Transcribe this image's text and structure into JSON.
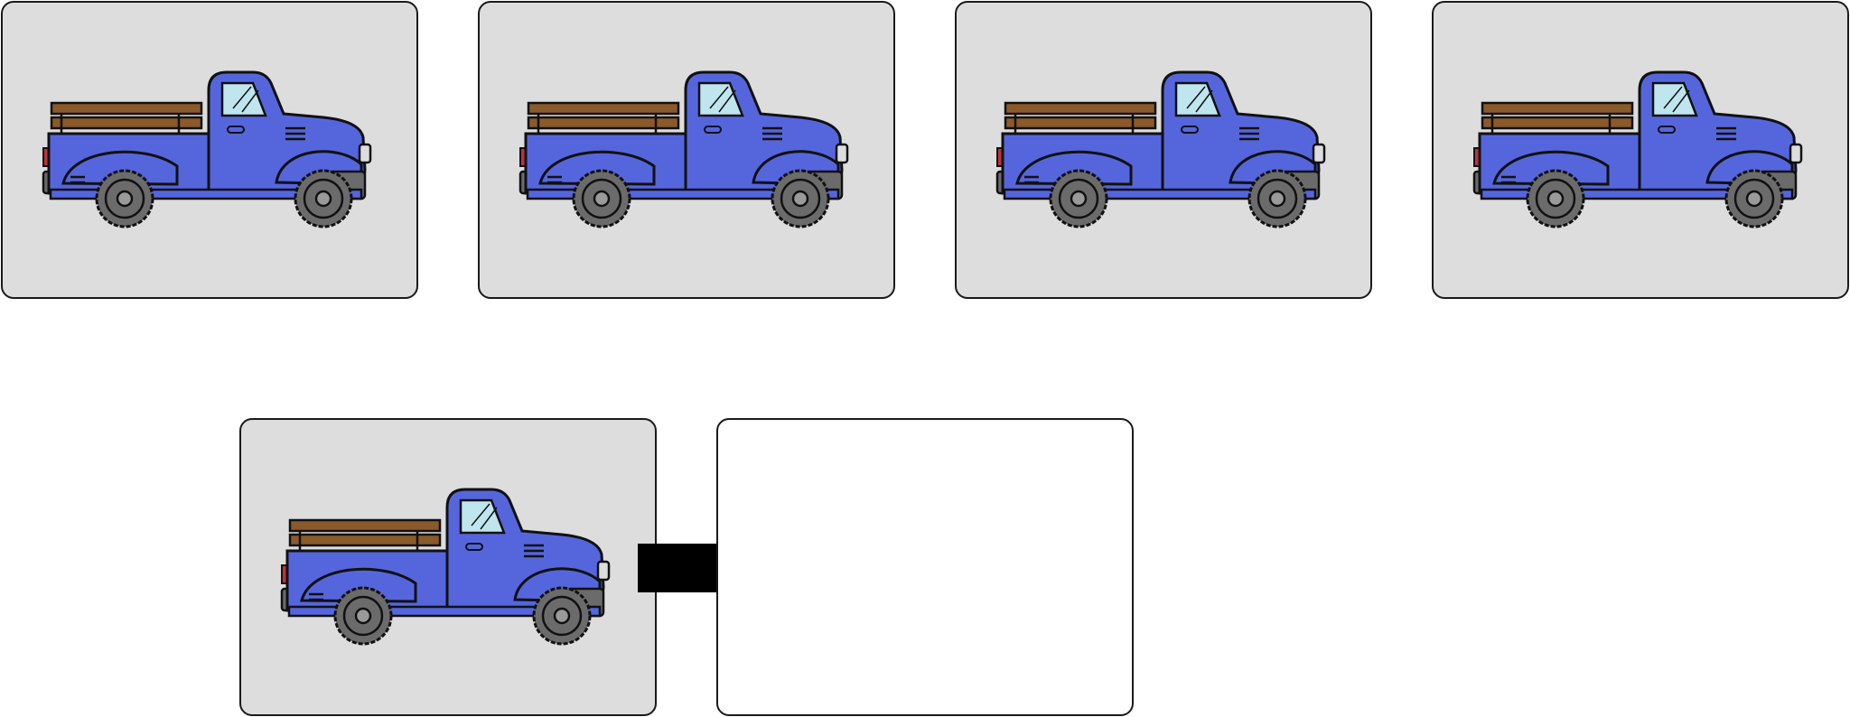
{
  "colors": {
    "card_background": "#dddddd",
    "empty_card_background": "#ffffff",
    "truck_body": "#5566dd",
    "truck_rails": "#8b5a2b",
    "wheel": "#6b6b6b",
    "window": "#bfe6ee",
    "tail_light": "#c0323a",
    "arrow": "#000000"
  },
  "sequence": [
    {
      "icon": "pickup-truck-icon"
    },
    {
      "icon": "pickup-truck-icon"
    },
    {
      "icon": "pickup-truck-icon"
    },
    {
      "icon": "pickup-truck-icon"
    }
  ],
  "question": {
    "given": {
      "icon": "pickup-truck-icon"
    },
    "connector": "right-arrow-icon",
    "answer": null
  }
}
